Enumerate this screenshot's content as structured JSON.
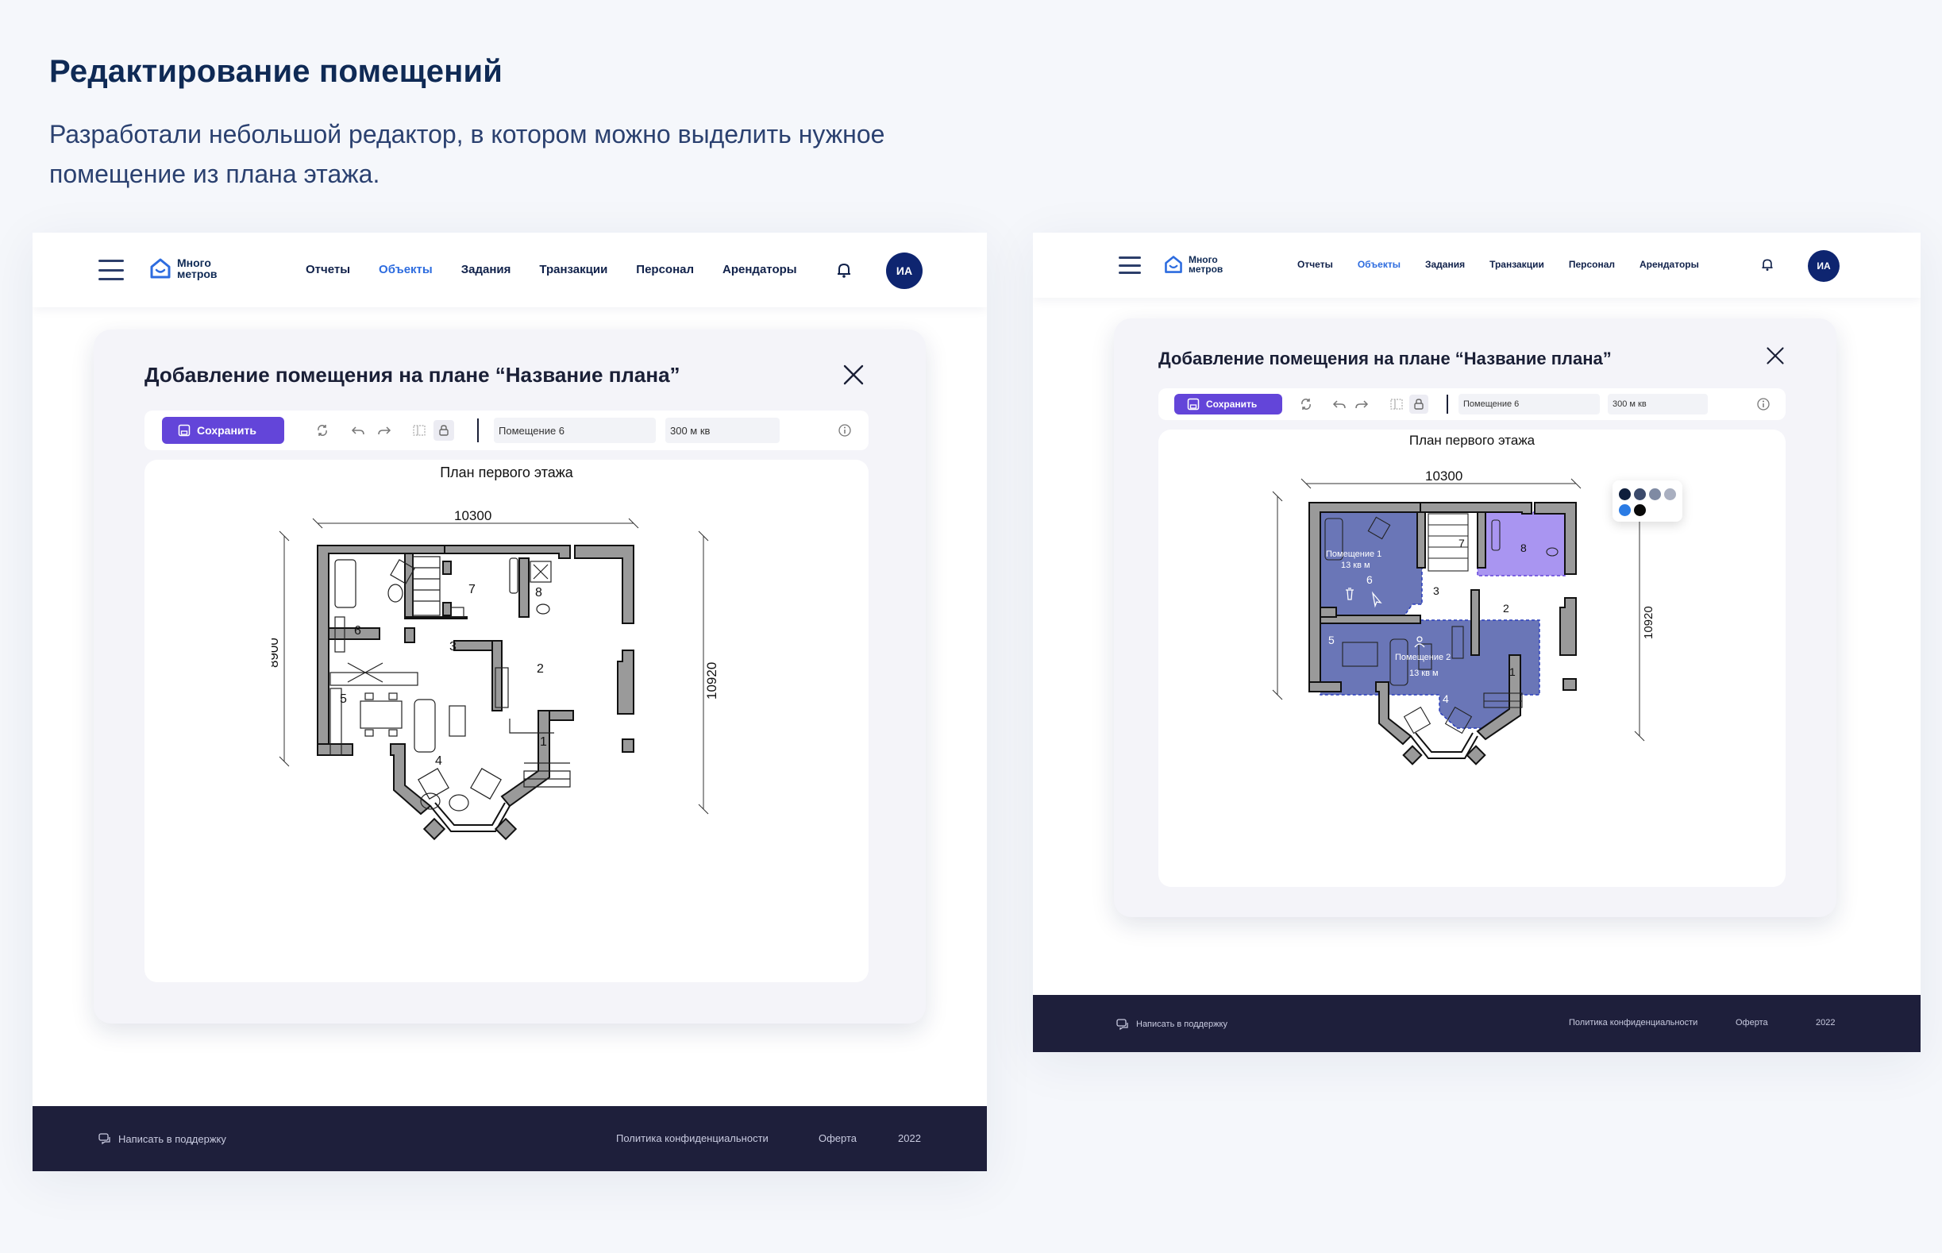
{
  "page": {
    "title": "Редактирование помещений",
    "subtitle": "Разработали небольшой редактор, в котором можно выделить нужное помещение из плана этажа."
  },
  "app": {
    "logo_line1": "Много",
    "logo_line2": "метров",
    "nav": [
      "Отчеты",
      "Объекты",
      "Задания",
      "Транзакции",
      "Персонал",
      "Арендаторы"
    ],
    "active_nav": "Объекты",
    "avatar": "ИА"
  },
  "modal": {
    "title": "Добавление помещения на плане “Название плана”",
    "save_label": "Сохранить",
    "room_name": "Помещение 6",
    "room_area": "300 м кв"
  },
  "plan": {
    "title": "План первого этажа",
    "width_dim": "10300",
    "height_dim": "8900",
    "depth_dim": "10920",
    "room_numbers": [
      "1",
      "2",
      "3",
      "4",
      "5",
      "6",
      "7",
      "8"
    ]
  },
  "selection": {
    "room1_name": "Помещение 1",
    "room1_area": "13 кв м",
    "room2_name": "Помещение 2",
    "room2_area": "13 кв м"
  },
  "palette_colors": [
    "#0f1f3d",
    "#3b4a6b",
    "#7f8aa3",
    "#a9afc0",
    "#d3d6df",
    "#ffffff",
    "#2a7be4",
    "#0a0a0a"
  ],
  "colors": {
    "accent": "#6345d9",
    "active_nav": "#2d6cdf",
    "avatar_bg": "#0e2570",
    "footer_bg": "#1e1f3b",
    "selection_dark": "#5563ad",
    "selection_purple": "#9a82ee"
  },
  "footer": {
    "support": "Написать в поддержку",
    "privacy": "Политика конфиденциальности",
    "offer": "Оферта",
    "year": "2022"
  }
}
